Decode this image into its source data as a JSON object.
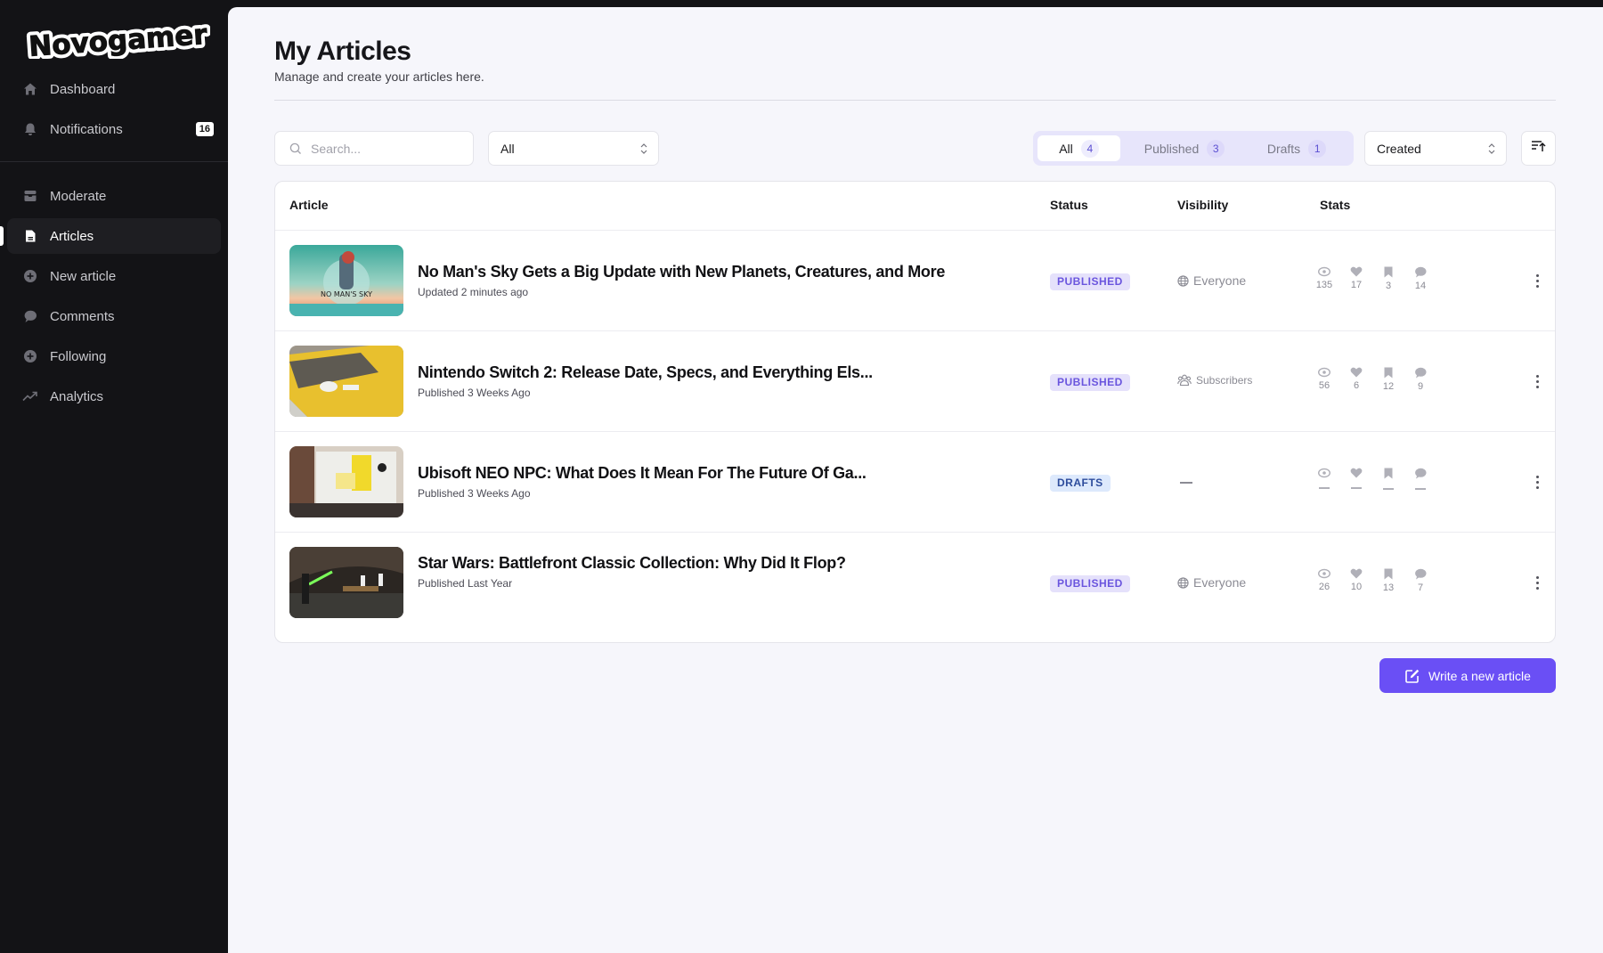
{
  "brand": {
    "name": "Novogamer"
  },
  "sidebar": {
    "items": [
      {
        "label": "Dashboard",
        "icon": "home-icon"
      },
      {
        "label": "Notifications",
        "icon": "bell-icon",
        "badge": "16"
      },
      {
        "label": "Moderate",
        "icon": "inbox-icon"
      },
      {
        "label": "Articles",
        "icon": "document-icon",
        "active": true
      },
      {
        "label": "New article",
        "icon": "plus-circle-icon"
      },
      {
        "label": "Comments",
        "icon": "chat-bubble-icon"
      },
      {
        "label": "Following",
        "icon": "plus-circle-icon"
      },
      {
        "label": "Analytics",
        "icon": "trending-up-icon"
      }
    ]
  },
  "header": {
    "title": "My Articles",
    "subtitle": "Manage and create your articles here."
  },
  "toolbar": {
    "search_placeholder": "Search...",
    "search_value": "",
    "filter_value": "All",
    "tabs": [
      {
        "label": "All",
        "count": "4",
        "active": true
      },
      {
        "label": "Published",
        "count": "3"
      },
      {
        "label": "Drafts",
        "count": "1"
      }
    ],
    "sort_value": "Created",
    "sort_direction_icon": "sort-ascending-icon"
  },
  "table": {
    "columns": [
      "Article",
      "Status",
      "Visibility",
      "Stats"
    ],
    "rows": [
      {
        "title": "No Man's Sky Gets a Big Update with New Planets, Creatures, and More",
        "meta": "Updated 2 minutes ago",
        "status": "PUBLISHED",
        "visibility": "Everyone",
        "stats": {
          "views": "135",
          "likes": "17",
          "bookmarks": "3",
          "comments": "14"
        }
      },
      {
        "title": "Nintendo Switch 2: Release Date, Specs, and Everything Els...",
        "meta": "Published 3 Weeks Ago",
        "status": "PUBLISHED",
        "visibility": "Subscribers",
        "stats": {
          "views": "56",
          "likes": "6",
          "bookmarks": "12",
          "comments": "9"
        }
      },
      {
        "title": "Ubisoft NEO NPC: What Does It Mean For The Future Of Ga...",
        "meta": "Published 3 Weeks Ago",
        "status": "DRAFTS",
        "visibility": "—",
        "stats": {
          "views": "—",
          "likes": "—",
          "bookmarks": "—",
          "comments": "—"
        }
      },
      {
        "title": "Star Wars: Battlefront Classic Collection: Why Did It Flop?",
        "meta": "Published Last Year",
        "status": "PUBLISHED",
        "visibility": "Everyone",
        "stats": {
          "views": "26",
          "likes": "10",
          "bookmarks": "13",
          "comments": "7"
        }
      }
    ]
  },
  "actions": {
    "write_label": "Write a new article"
  },
  "colors": {
    "accent": "#6a4ff5",
    "sidebar_bg": "#131316",
    "page_bg": "#f6f6fb",
    "published_badge_bg": "#e5e1fb",
    "published_badge_fg": "#6a55de",
    "drafts_badge_bg": "#dde9fc",
    "drafts_badge_fg": "#2d4c9c"
  }
}
